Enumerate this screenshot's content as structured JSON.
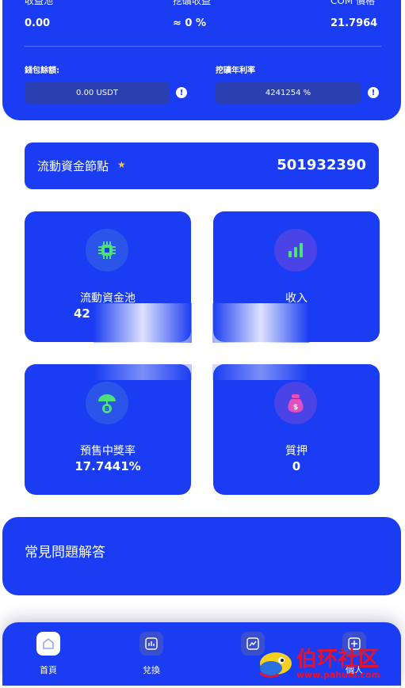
{
  "top_panel": {
    "stats": [
      {
        "label": "收益池",
        "value": "0.00"
      },
      {
        "label": "挖礦收益",
        "value": "≈ 0 %"
      },
      {
        "label": "COM 價格",
        "value": "21.7964"
      }
    ],
    "wallet_balance_label": "錢包餘額:",
    "wallet_balance_value": "0.00 USDT",
    "mining_rate_label": "挖礦年利率",
    "mining_rate_value": "4241254 %",
    "info_glyph": "!"
  },
  "node_bar": {
    "title": "流動資金節點",
    "star_glyph": "★",
    "value": "501932390"
  },
  "cards": [
    {
      "label": "流動資金池",
      "value": "42",
      "icon": "chip-icon"
    },
    {
      "label": "收入",
      "value": "",
      "icon": "bar-chart-icon"
    },
    {
      "label": "預售中獎率",
      "value": "17.7441%",
      "icon": "umbrella-coin-icon"
    },
    {
      "label": "質押",
      "value": "0",
      "icon": "money-bag-icon"
    }
  ],
  "faq": {
    "title": "常見問題解答"
  },
  "tabbar": {
    "items": [
      {
        "label": "首頁",
        "icon": "home-icon",
        "active": true
      },
      {
        "label": "兌換",
        "icon": "chart-icon",
        "active": false
      },
      {
        "label": "",
        "icon": "trend-icon",
        "active": false
      },
      {
        "label": "個人",
        "icon": "plus-icon",
        "active": false
      }
    ]
  },
  "watermark": {
    "text": "伯环社区",
    "url": "www.pahuai.com"
  },
  "colors": {
    "primary": "#1a3cf2",
    "field": "#2b3fb0",
    "star": "#f4c430",
    "green": "#4ee07a",
    "pink": "#e24fc0"
  }
}
